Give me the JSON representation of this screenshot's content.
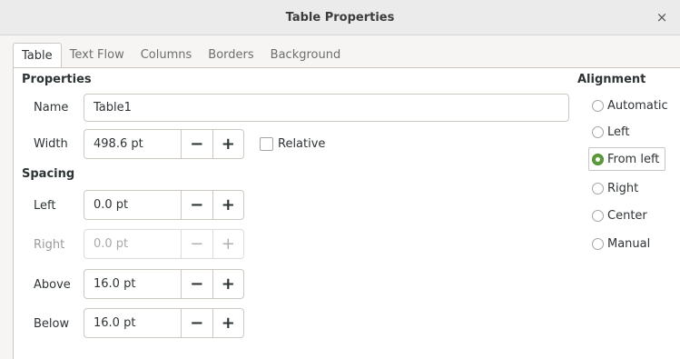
{
  "window": {
    "title": "Table Properties",
    "close_glyph": "×"
  },
  "tabs": [
    {
      "label": "Table",
      "active": true
    },
    {
      "label": "Text Flow",
      "active": false
    },
    {
      "label": "Columns",
      "active": false
    },
    {
      "label": "Borders",
      "active": false
    },
    {
      "label": "Background",
      "active": false
    }
  ],
  "properties": {
    "heading": "Properties",
    "name_label": "Name",
    "name_value": "Table1",
    "width_label": "Width",
    "width_value": "498.6 pt",
    "relative_label": "Relative",
    "relative_checked": false
  },
  "spacing": {
    "heading": "Spacing",
    "left_label": "Left",
    "left_value": "0.0 pt",
    "right_label": "Right",
    "right_value": "0.0 pt",
    "above_label": "Above",
    "above_value": "16.0 pt",
    "below_label": "Below",
    "below_value": "16.0 pt"
  },
  "stepper": {
    "minus": "−",
    "plus": "+"
  },
  "alignment": {
    "heading": "Alignment",
    "options": [
      "Automatic",
      "Left",
      "From left",
      "Right",
      "Center",
      "Manual"
    ],
    "selected": "From left"
  },
  "colors": {
    "accent": "#5c9a3b"
  }
}
